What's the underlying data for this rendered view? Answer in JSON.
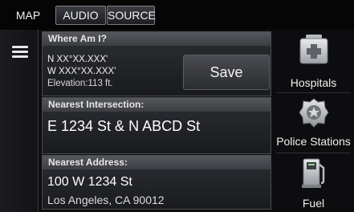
{
  "tabs": {
    "map": "MAP",
    "audio": "AUDIO",
    "source": "SOURCE"
  },
  "where_am_i": {
    "header": "Where Am I?",
    "latitude": "N XX°XX.XXX'",
    "longitude": "W XXX°XX.XXX'",
    "elevation": "Elevation:113 ft.",
    "save_label": "Save"
  },
  "nearest_intersection": {
    "header": "Nearest Intersection:",
    "value": "E 1234 St & N ABCD St"
  },
  "nearest_address": {
    "header": "Nearest Address:",
    "line1": "100 W 1234 St",
    "line2": "Los Angeles, CA 90012"
  },
  "categories": [
    {
      "label": "Hospitals",
      "icon": "hospital-icon"
    },
    {
      "label": "Police Stations",
      "icon": "police-badge-icon"
    },
    {
      "label": "Fuel",
      "icon": "fuel-pump-icon"
    }
  ]
}
